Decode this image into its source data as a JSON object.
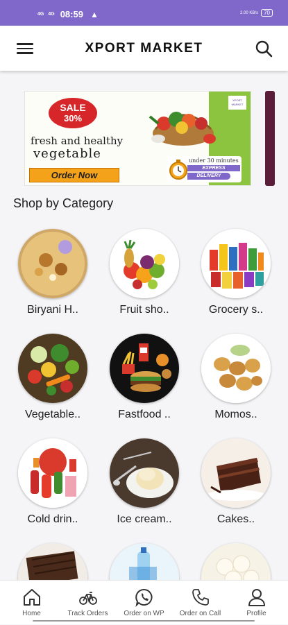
{
  "status_bar": {
    "signal_1": "4G",
    "signal_2": "4G",
    "time": "08:59",
    "net_speed": "2.00 KB/s",
    "battery": "70"
  },
  "header": {
    "title": "XPORT MARKET",
    "menu_icon": "hamburger-menu-icon",
    "search_icon": "search-icon"
  },
  "banner": {
    "sale_line1": "SALE",
    "sale_line2": "30%",
    "headline_1": "fresh and healthy",
    "headline_2": "vegetable",
    "cta": "Order Now",
    "express_line1": "under 30 minutes",
    "express_line2": "EXPRESS",
    "express_line3": "DELIVERY"
  },
  "section": {
    "title": "Shop by Category"
  },
  "categories": [
    {
      "label": "Biryani H..",
      "icon": "biryani-image"
    },
    {
      "label": "Fruit sho..",
      "icon": "fruit-image"
    },
    {
      "label": "Grocery s..",
      "icon": "grocery-image"
    },
    {
      "label": "Vegetable..",
      "icon": "vegetable-image"
    },
    {
      "label": "Fastfood ..",
      "icon": "fastfood-image"
    },
    {
      "label": "Momos..",
      "icon": "momos-image"
    },
    {
      "label": "Cold drin..",
      "icon": "cold-drinks-image"
    },
    {
      "label": "Ice cream..",
      "icon": "ice-cream-image"
    },
    {
      "label": "Cakes..",
      "icon": "cake-image"
    }
  ],
  "bottom_nav": [
    {
      "label": "Home",
      "icon": "home-icon"
    },
    {
      "label": "Track Orders",
      "icon": "bicycle-icon"
    },
    {
      "label": "Order on WP",
      "icon": "whatsapp-icon"
    },
    {
      "label": "Order on Call",
      "icon": "phone-icon"
    },
    {
      "label": "Profile",
      "icon": "user-icon"
    }
  ],
  "colors": {
    "accent": "#7f68c9",
    "sale_red": "#d7262a",
    "cta_orange": "#f5a21b"
  }
}
